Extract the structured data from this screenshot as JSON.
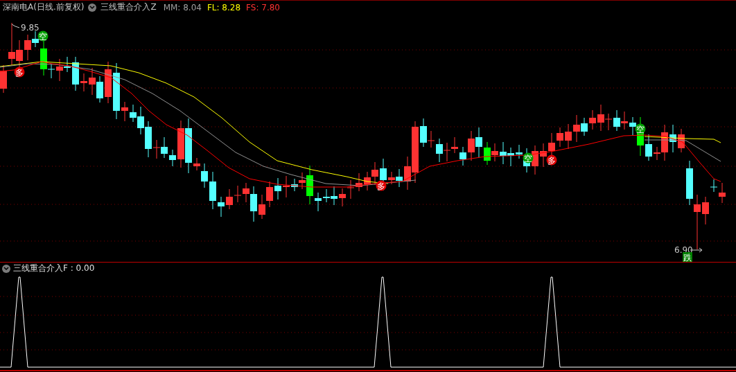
{
  "main_panel": {
    "symbol": "深南电A(日线.前复权)",
    "indicator": "三线重合介入Z",
    "legend": [
      {
        "label": "MM: 8.04",
        "color": "#a0a0a0"
      },
      {
        "label": "FL: 8.28",
        "color": "#ffff00"
      },
      {
        "label": "FS: 7.80",
        "color": "#ff3232"
      }
    ],
    "price_labels": [
      "9.85",
      "6.90"
    ],
    "signals": [
      {
        "text": "空",
        "kind": "short"
      },
      {
        "text": "多",
        "kind": "long"
      },
      {
        "text": "多",
        "kind": "long"
      },
      {
        "text": "空",
        "kind": "short"
      },
      {
        "text": "多",
        "kind": "long"
      },
      {
        "text": "空",
        "kind": "short"
      },
      {
        "text": "跌",
        "kind": "fall"
      }
    ]
  },
  "sub_panel": {
    "title": "三线重合介入F : 0.00"
  }
}
